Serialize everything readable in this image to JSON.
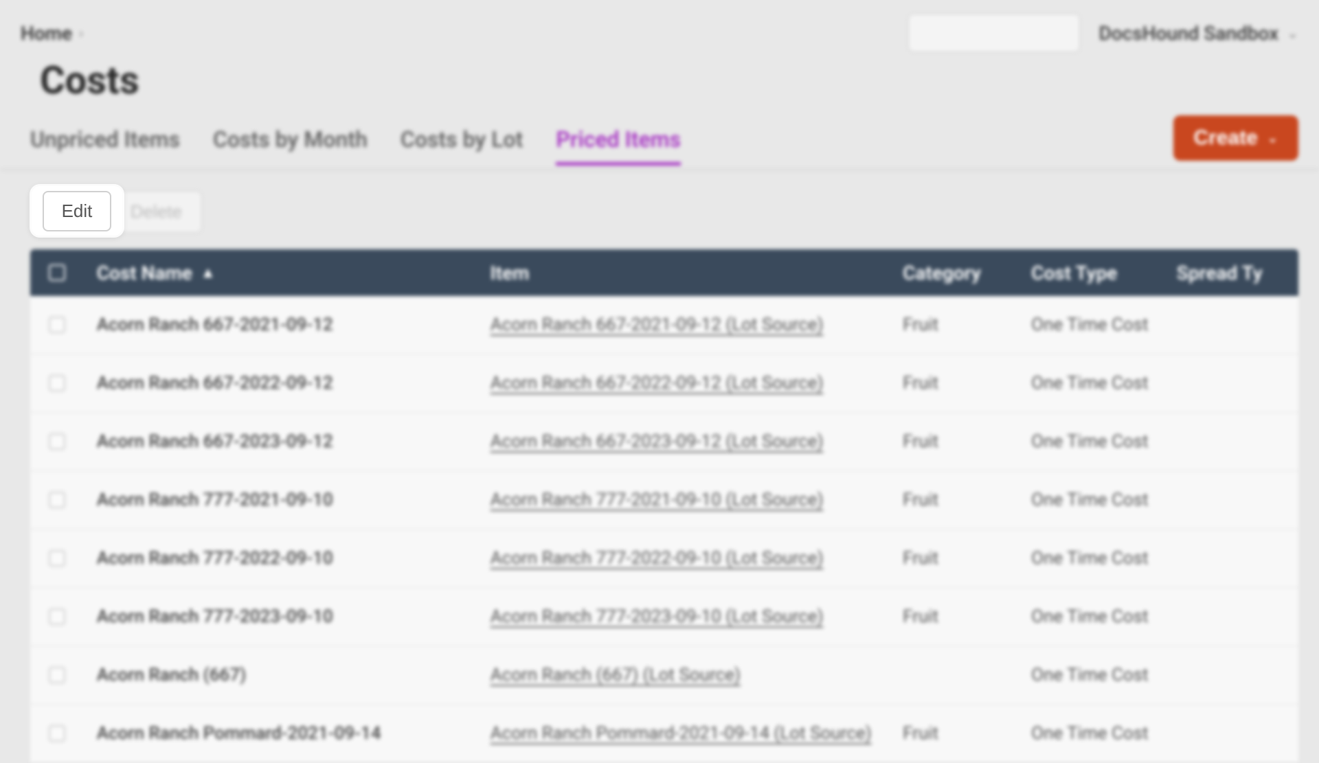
{
  "breadcrumb": {
    "home": "Home"
  },
  "org_selector": {
    "label": "DocsHound Sandbox"
  },
  "search": {
    "placeholder": ""
  },
  "page": {
    "title": "Costs"
  },
  "tabs": [
    {
      "label": "Unpriced Items",
      "active": false
    },
    {
      "label": "Costs by Month",
      "active": false
    },
    {
      "label": "Costs by Lot",
      "active": false
    },
    {
      "label": "Priced Items",
      "active": true
    }
  ],
  "create_btn": {
    "label": "Create"
  },
  "actions": {
    "edit": "Edit",
    "delete": "Delete"
  },
  "highlight": {
    "label": "Edit"
  },
  "columns": {
    "name": "Cost Name",
    "item": "Item",
    "category": "Category",
    "cost_type": "Cost Type",
    "spread_type": "Spread Ty"
  },
  "rows": [
    {
      "name": "Acorn Ranch 667-2021-09-12",
      "item": "Acorn Ranch 667-2021-09-12 (Lot Source)",
      "category": "Fruit",
      "cost_type": "One Time Cost"
    },
    {
      "name": "Acorn Ranch 667-2022-09-12",
      "item": "Acorn Ranch 667-2022-09-12 (Lot Source)",
      "category": "Fruit",
      "cost_type": "One Time Cost"
    },
    {
      "name": "Acorn Ranch 667-2023-09-12",
      "item": "Acorn Ranch 667-2023-09-12 (Lot Source)",
      "category": "Fruit",
      "cost_type": "One Time Cost"
    },
    {
      "name": "Acorn Ranch 777-2021-09-10",
      "item": "Acorn Ranch 777-2021-09-10 (Lot Source)",
      "category": "Fruit",
      "cost_type": "One Time Cost"
    },
    {
      "name": "Acorn Ranch 777-2022-09-10",
      "item": "Acorn Ranch 777-2022-09-10 (Lot Source)",
      "category": "Fruit",
      "cost_type": "One Time Cost"
    },
    {
      "name": "Acorn Ranch 777-2023-09-10",
      "item": "Acorn Ranch 777-2023-09-10 (Lot Source)",
      "category": "Fruit",
      "cost_type": "One Time Cost"
    },
    {
      "name": "Acorn Ranch (667)",
      "item": "Acorn Ranch (667) (Lot Source)",
      "category": "",
      "cost_type": "One Time Cost"
    },
    {
      "name": "Acorn Ranch Pommard-2021-09-14",
      "item": "Acorn Ranch Pommard-2021-09-14 (Lot Source)",
      "category": "Fruit",
      "cost_type": "One Time Cost"
    }
  ]
}
